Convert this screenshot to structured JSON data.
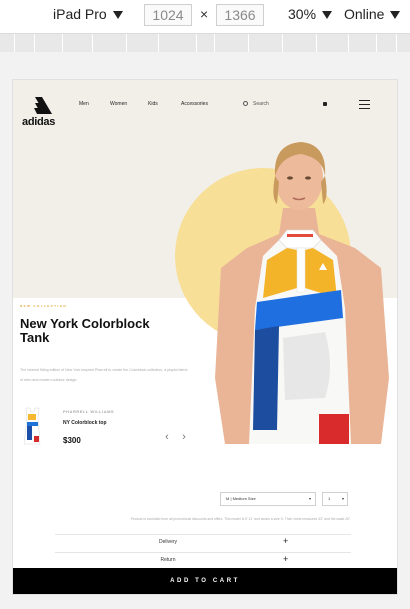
{
  "devtools": {
    "device": "iPad Pro",
    "width": "1024",
    "height": "1366",
    "times": "×",
    "zoom": "30%",
    "throttle": "Online"
  },
  "brand": {
    "name": "adidas"
  },
  "nav": {
    "items": [
      {
        "label": "Men"
      },
      {
        "label": "Women"
      },
      {
        "label": "Kids"
      },
      {
        "label": "Accessories"
      }
    ],
    "search_label": "Search"
  },
  "hero": {
    "collection_label": "NEW COLLECTION",
    "title": "New York Colorblock Tank",
    "description": "The relaxed fitting edition of New York inspired Pharrell to create the Colorblock collection, a playful blend of retro and modern outdoor design."
  },
  "product": {
    "designer": "PHARRELL WILLIAMS",
    "name": "NY Colorblock top",
    "price": "$300"
  },
  "options": {
    "size_value": "M  |  Medium Size",
    "qty_value": "1"
  },
  "fit_note": "Product is excluded from all promotional discounts and offers. This model is 5' 11\" and wears a size S. Their chest measures 33\" and the waist 26\".",
  "accordion": {
    "delivery": "Delivery",
    "return": "Return",
    "plus": "+"
  },
  "cart_button": "ADD TO CART",
  "colors": {
    "hero_bg": "#f2efe8",
    "sun": "#f8df97",
    "accent": "#e0a83a",
    "cart_bg": "#000000"
  }
}
